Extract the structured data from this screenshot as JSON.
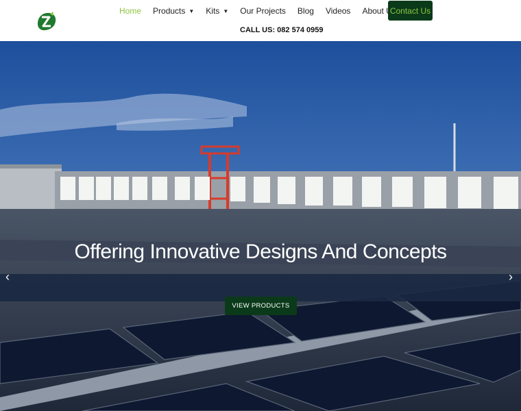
{
  "header": {
    "logo_icon": "leaf-logo-icon",
    "nav": [
      {
        "label": "Home",
        "active": true,
        "has_dropdown": false
      },
      {
        "label": "Products",
        "active": false,
        "has_dropdown": true
      },
      {
        "label": "Kits",
        "active": false,
        "has_dropdown": true
      },
      {
        "label": "Our Projects",
        "active": false,
        "has_dropdown": false
      },
      {
        "label": "Blog",
        "active": false,
        "has_dropdown": false
      },
      {
        "label": "Videos",
        "active": false,
        "has_dropdown": false
      },
      {
        "label": "About Us",
        "active": false,
        "has_dropdown": false
      }
    ],
    "contact_label": "Contact Us",
    "call_us": "CALL US: 082 574 0959"
  },
  "hero": {
    "title": "Offering Innovative Designs And Concepts",
    "button_label": "VIEW PRODUCTS",
    "prev_arrow": "‹",
    "next_arrow": "›"
  },
  "colors": {
    "accent_green": "#8cc63f",
    "dark_green": "#0b3a1a"
  }
}
